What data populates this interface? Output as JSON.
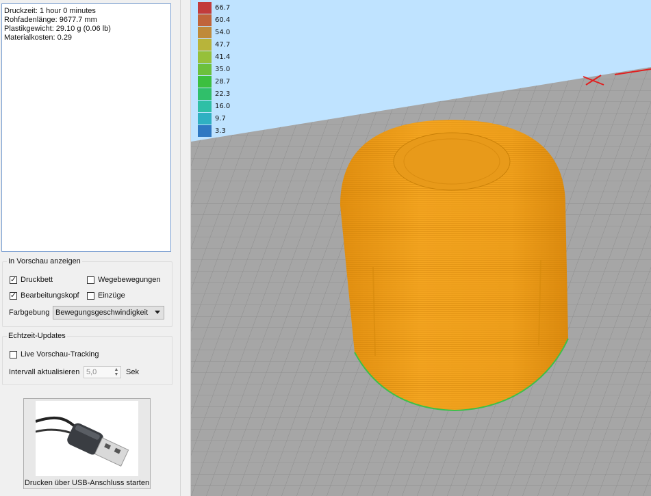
{
  "info": {
    "print_time": "Druckzeit: 1 hour 0 minutes",
    "filament_length": "Rohfadenlänge: 9677.7 mm",
    "plastic_weight": "Plastikgewicht: 29.10 g (0.06 lb)",
    "material_cost": "Materialkosten: 0.29"
  },
  "preview_group": {
    "title": "In Vorschau anzeigen",
    "print_bed": {
      "label": "Druckbett",
      "checked": true
    },
    "travel_moves": {
      "label": "Wegebewegungen",
      "checked": false
    },
    "toolhead": {
      "label": "Bearbeitungskopf",
      "checked": true
    },
    "retractions": {
      "label": "Einzüge",
      "checked": false
    },
    "coloring_label": "Farbgebung",
    "coloring_value": "Bewegungsgeschwindigkeit"
  },
  "realtime_group": {
    "title": "Echtzeit-Updates",
    "live_tracking": {
      "label": "Live Vorschau-Tracking",
      "checked": false
    },
    "interval_label": "Intervall aktualisieren",
    "interval_value": "5,0",
    "interval_unit": "Sek"
  },
  "usb_button": {
    "label": "Drucken über USB-Anschluss starten"
  },
  "legend": [
    {
      "value": "66.7",
      "color": "#c23b3b"
    },
    {
      "value": "60.4",
      "color": "#c0643a"
    },
    {
      "value": "54.0",
      "color": "#bf8a3a"
    },
    {
      "value": "47.7",
      "color": "#b8b43a"
    },
    {
      "value": "41.4",
      "color": "#96c03a"
    },
    {
      "value": "35.0",
      "color": "#6cc03c"
    },
    {
      "value": "28.7",
      "color": "#3cbf3f"
    },
    {
      "value": "22.3",
      "color": "#30bf6a"
    },
    {
      "value": "16.0",
      "color": "#2fbfa6"
    },
    {
      "value": "9.7",
      "color": "#2fb0c2"
    },
    {
      "value": "3.3",
      "color": "#2f78c2"
    }
  ],
  "colors": {
    "sky": "#bfe3ff",
    "bed": "#a6a6a6",
    "print_orange": "#f0a21e"
  }
}
